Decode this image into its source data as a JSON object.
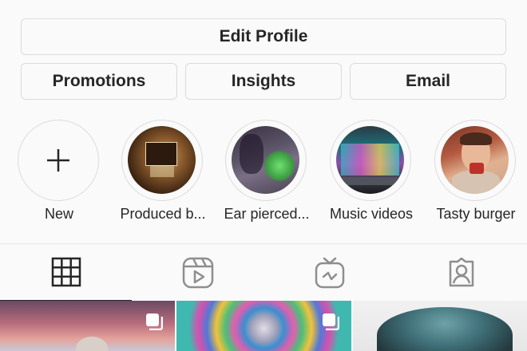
{
  "profile_actions": {
    "edit_profile": "Edit Profile",
    "promotions": "Promotions",
    "insights": "Insights",
    "email": "Email"
  },
  "highlights": [
    {
      "label": "New",
      "icon": "plus-icon"
    },
    {
      "label": "Produced b..."
    },
    {
      "label": "Ear pierced..."
    },
    {
      "label": "Music videos"
    },
    {
      "label": "Tasty burger"
    }
  ],
  "tabs": [
    {
      "name": "grid",
      "icon": "grid-icon",
      "active": true
    },
    {
      "name": "reels",
      "icon": "reels-icon",
      "active": false
    },
    {
      "name": "igtv",
      "icon": "igtv-icon",
      "active": false
    },
    {
      "name": "tagged",
      "icon": "tagged-icon",
      "active": false
    }
  ],
  "colors": {
    "border": "#dbdbdb",
    "text": "#262626",
    "background": "#fafafa"
  }
}
